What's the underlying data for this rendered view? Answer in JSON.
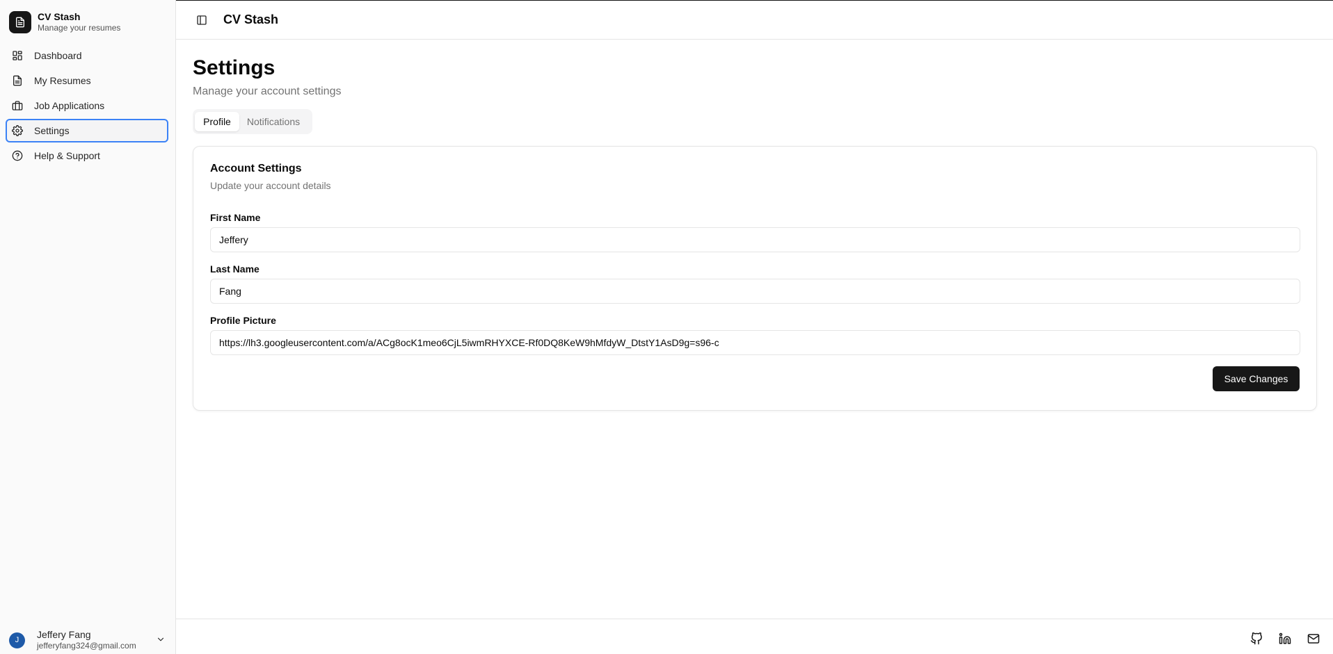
{
  "app": {
    "name": "CV Stash",
    "tagline": "Manage your resumes"
  },
  "sidebar": {
    "items": [
      {
        "label": "Dashboard",
        "icon": "dashboard-icon"
      },
      {
        "label": "My Resumes",
        "icon": "file-icon"
      },
      {
        "label": "Job Applications",
        "icon": "briefcase-icon"
      },
      {
        "label": "Settings",
        "icon": "gear-icon",
        "active": true
      },
      {
        "label": "Help & Support",
        "icon": "help-circle-icon"
      }
    ]
  },
  "user": {
    "initial": "J",
    "name": "Jeffery Fang",
    "email": "jefferyfang324@gmail.com"
  },
  "header": {
    "title": "CV Stash"
  },
  "page": {
    "title": "Settings",
    "subtitle": "Manage your account settings"
  },
  "tabs": [
    {
      "label": "Profile",
      "active": true
    },
    {
      "label": "Notifications",
      "active": false
    }
  ],
  "card": {
    "title": "Account Settings",
    "subtitle": "Update your account details",
    "fields": [
      {
        "label": "First Name",
        "value": "Jeffery"
      },
      {
        "label": "Last Name",
        "value": "Fang"
      },
      {
        "label": "Profile Picture",
        "value": "https://lh3.googleusercontent.com/a/ACg8ocK1meo6CjL5iwmRHYXCE-Rf0DQ8KeW9hMfdyW_DtstY1AsD9g=s96-c"
      }
    ],
    "save_label": "Save Changes"
  },
  "footer": {
    "icons": [
      "github-icon",
      "linkedin-icon",
      "mail-icon"
    ]
  },
  "colors": {
    "accent": "#3b82f6",
    "primary_button": "#171717",
    "avatar": "#1e5aa8"
  }
}
